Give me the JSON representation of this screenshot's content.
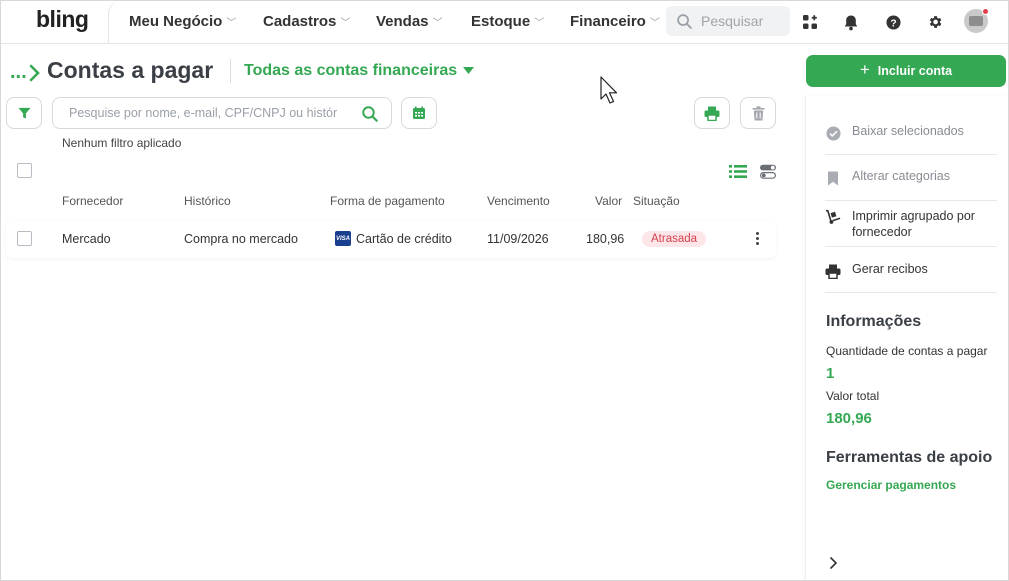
{
  "header": {
    "logo": "bling",
    "menu": [
      {
        "label": "Meu Negócio"
      },
      {
        "label": "Cadastros"
      },
      {
        "label": "Vendas"
      },
      {
        "label": "Estoque"
      },
      {
        "label": "Financeiro"
      }
    ],
    "search_placeholder": "Pesquisar"
  },
  "title": {
    "breadcrumb": "...",
    "page_title": "Contas a pagar",
    "filter": "Todas as contas financeiras"
  },
  "toolbar": {
    "search_placeholder": "Pesquise por nome, e-mail, CPF/CNPJ ou histórico",
    "no_filter": "Nenhum filtro aplicado"
  },
  "table": {
    "columns": [
      "Fornecedor",
      "Histórico",
      "Forma de pagamento",
      "Vencimento",
      "Valor",
      "Situação"
    ],
    "rows": [
      {
        "fornecedor": "Mercado",
        "historico": "Compra no mercado",
        "forma_pagamento": "Cartão de crédito",
        "vencimento": "11/09/2026",
        "valor": "180,96",
        "situacao": "Atrasada"
      }
    ]
  },
  "sidebar": {
    "include_button": "Incluir conta",
    "actions": [
      {
        "label": "Baixar selecionados"
      },
      {
        "label": "Alterar categorias"
      },
      {
        "label": "Imprimir agrupado por fornecedor"
      },
      {
        "label": "Gerar recibos"
      }
    ],
    "info_title": "Informações",
    "qty_label": "Quantidade de contas a pagar",
    "qty_value": "1",
    "total_label": "Valor total",
    "total_value": "180,96",
    "tools_title": "Ferramentas de apoio",
    "tools_link": "Gerenciar pagamentos"
  },
  "colors": {
    "accent": "#35a853",
    "overdue_bg": "#fde6e8",
    "overdue_text": "#d5404e"
  }
}
